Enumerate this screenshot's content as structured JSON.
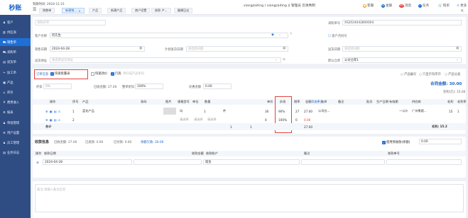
{
  "app": {
    "logo": "秒账"
  },
  "sidebar": {
    "items": [
      {
        "icon": "person-icon",
        "label": "客户"
      },
      {
        "icon": "chart-icon",
        "label": "供应商"
      },
      {
        "icon": "cart-icon",
        "label": "销售单"
      },
      {
        "icon": "cart-icon",
        "label": "采购单"
      },
      {
        "icon": "doc-icon",
        "label": "退货单"
      },
      {
        "icon": "wrench-icon",
        "label": "加工单"
      },
      {
        "icon": "box-icon",
        "label": "产品"
      },
      {
        "icon": "home-icon",
        "label": "库存"
      },
      {
        "icon": "money-icon",
        "label": "费用收入"
      },
      {
        "icon": "gear-icon",
        "label": "报表"
      },
      {
        "icon": "person-icon",
        "label": "审批管理"
      },
      {
        "icon": "gear-icon",
        "label": "用户设置"
      },
      {
        "icon": "person-icon",
        "label": "员工管理"
      },
      {
        "icon": "doc-icon",
        "label": "业务日志"
      }
    ]
  },
  "topbar": {
    "datetime": "到期时间: 2024-11-21",
    "tabs": [
      "销售单",
      "新建销...",
      "产品",
      "新建产品",
      "商户设置",
      "收款 卢...",
      "编辑日志"
    ],
    "userline": "xiangzaiting ( xiangzaiting )| 管理员 云清秀明",
    "actions": [
      "客服",
      "金额",
      "消息",
      "任务",
      "购买",
      "更多"
    ],
    "message_count": "99"
  },
  "form": {
    "title_placeholder": "采购开单",
    "doc_no_label": "采购单号",
    "doc_no": "XS2024042800004",
    "customer_label": "客户名称",
    "customer": "何先生",
    "customer_tag": "*",
    "contract_label": "客户合同号",
    "date_label": "销售日期",
    "date": "2024-04-28",
    "delivery_label": "计划发货日期",
    "delivery_placeholder": "请选择日期",
    "arrive_label": "送货日期",
    "arrive_placeholder": "请选择日期",
    "delivery_addr_label": "送货地址",
    "delivery_addr_placeholder": "请选择送货地址",
    "warehouse_label": "默认仓库",
    "warehouse": "公司仓库1"
  },
  "options": {
    "order_info": "订单信息",
    "quick_add": "快速批量录",
    "quick_fill": "快速改价",
    "show_label": "行高",
    "search_placeholder": "请扫描产品条码",
    "right_opts": [
      "产品编号",
      "只显示有库存",
      "产品分类"
    ]
  },
  "summary": {
    "discount_label": "折扣",
    "discount": "0%",
    "total_qty_label": "已收金额",
    "total_qty": "27.00",
    "ratio_label": "整单折扣",
    "ratio": "100%",
    "fee_label": "优惠金额",
    "fee": "0.00",
    "total_label": "合同金额:",
    "total": "30.00",
    "deposit_label": "毛利(元)",
    "deposit": "15.00"
  },
  "table": {
    "headers": [
      "操作",
      "序号",
      "产品",
      "条码",
      "图片",
      "规格型号",
      "单位",
      "数量",
      "单价",
      "折扣",
      "税率",
      "金额",
      "仓库",
      "备注",
      "批次",
      "生产日期",
      "有效期",
      "供应商",
      "毛利",
      "毛利率"
    ],
    "batch_btn": "添加更多",
    "rows": [
      {
        "no": "1",
        "product": "蓝花产品",
        "spec": "均",
        "unit": "个",
        "qty": "1",
        "price": "件",
        "p2": "30",
        "discount": "90%",
        "tax": "27",
        "amount": "27.00",
        "warehouse": "公司仓...",
        "pack": "一公斤",
        "supplier": "广州果蔬...",
        "profit": "15",
        "rate": "1"
      },
      {
        "no": "2",
        "product": "",
        "spec": "请选择",
        "unit": "请选择",
        "qty": "请选择",
        "price": "",
        "p2": "0",
        "discount": "100%",
        "tax": "0",
        "amount": "0.00",
        "warehouse": "",
        "pack": "",
        "supplier": "",
        "profit": "",
        "rate": ""
      }
    ],
    "total_label": "合计",
    "total_qty": "1",
    "total_qty2": "1",
    "total_amount": "27.00",
    "total_profit": "15.2",
    "profit_label": "毛利: 15.2"
  },
  "receipt": {
    "title": "收款信息",
    "paid": "已收金额: 27.00",
    "unpaid": "已退款: 0.00",
    "remain": "已付款: 0.00",
    "balance": "余额欠款: 30.00",
    "use_prepaid": "使用预收款(余额)",
    "prepaid": "0.00",
    "headers": [
      "操作",
      "收款日期",
      "收款金额",
      "收款账户",
      "备注",
      "收款单号"
    ],
    "row": {
      "date": "2024-04-28",
      "account": "现金"
    }
  },
  "remarks": {
    "placeholder": "请输入备注信息"
  }
}
